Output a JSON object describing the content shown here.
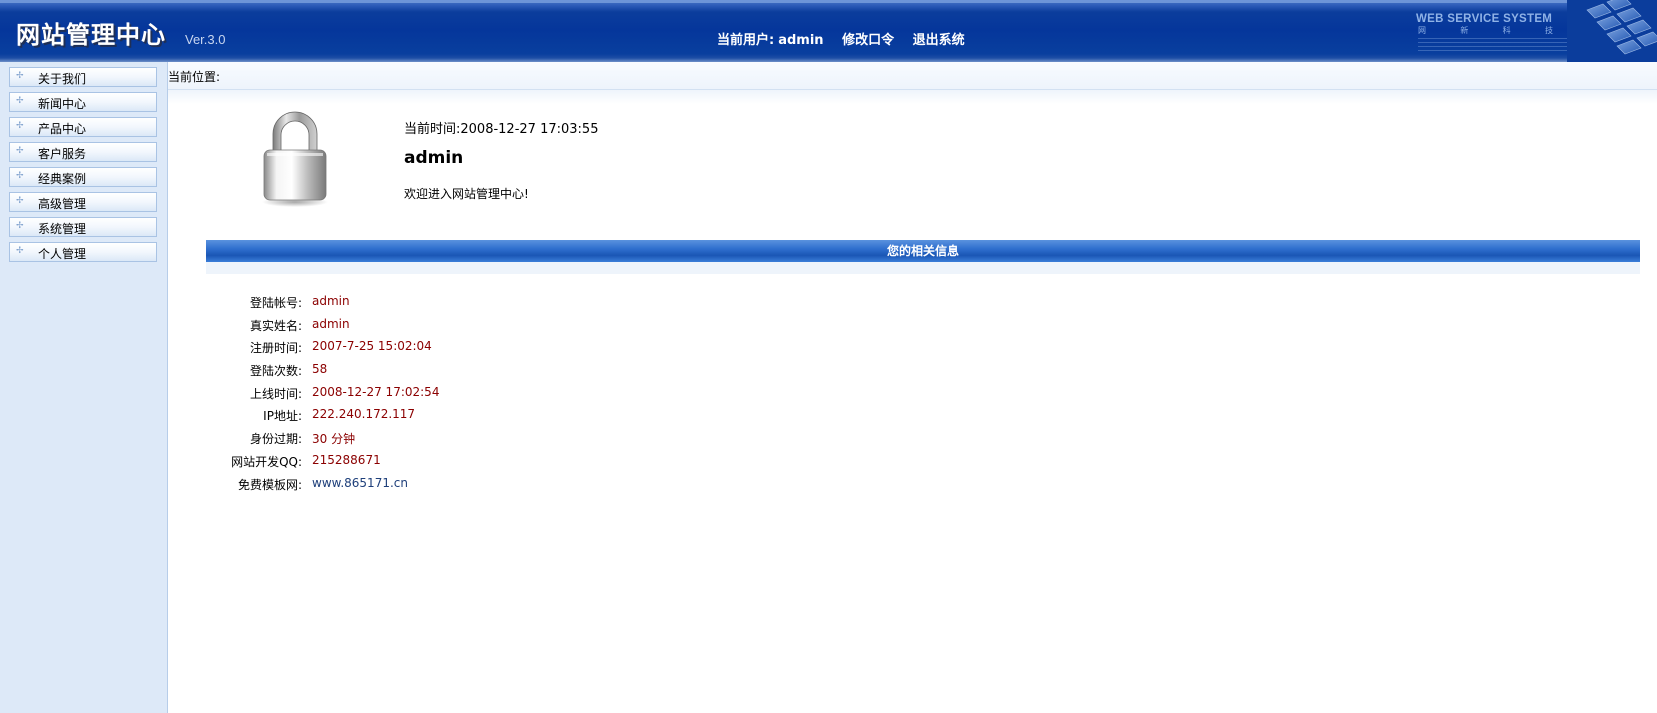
{
  "header": {
    "logo": "网站管理中心",
    "version": "Ver.3.0",
    "current_user_label": "当前用户:",
    "current_user": "admin",
    "change_password": "修改口令",
    "logout": "退出系统",
    "brand_en": "WEB SERVICE SYSTEM",
    "brand_cn_chars": [
      "网",
      "新",
      "科",
      "技"
    ]
  },
  "sidebar": {
    "items": [
      {
        "label": "关于我们"
      },
      {
        "label": "新闻中心"
      },
      {
        "label": "产品中心"
      },
      {
        "label": "客户服务"
      },
      {
        "label": "经典案例"
      },
      {
        "label": "高级管理"
      },
      {
        "label": "系统管理"
      },
      {
        "label": "个人管理"
      }
    ]
  },
  "breadcrumb": {
    "label": "当前位置:"
  },
  "welcome": {
    "time_label": "当前时间:",
    "time_value": "2008-12-27 17:03:55",
    "username": "admin",
    "message": "欢迎进入网站管理中心!"
  },
  "info_section": {
    "title": "您的相关信息",
    "rows": [
      {
        "key": "登陆帐号:",
        "value": "admin"
      },
      {
        "key": "真实姓名:",
        "value": "admin"
      },
      {
        "key": "注册时间:",
        "value": "2007-7-25 15:02:04"
      },
      {
        "key": "登陆次数:",
        "value": "58"
      },
      {
        "key": "上线时间:",
        "value": "2008-12-27 17:02:54"
      },
      {
        "key": "IP地址:",
        "value": "222.240.172.117"
      },
      {
        "key": "身份过期:",
        "value": "30 分钟"
      },
      {
        "key": "网站开发QQ:",
        "value": "215288671"
      },
      {
        "key": "免费模板网:",
        "value": "www.865171.cn"
      }
    ]
  },
  "colors": {
    "header_blue": "#05369b",
    "sidebar_bg": "#dde9f8",
    "value_red": "#8b0000",
    "link_blue": "#1e3f7a"
  },
  "icons": {
    "lock": "lock-icon",
    "menu_bullet": "bullet-icon"
  }
}
